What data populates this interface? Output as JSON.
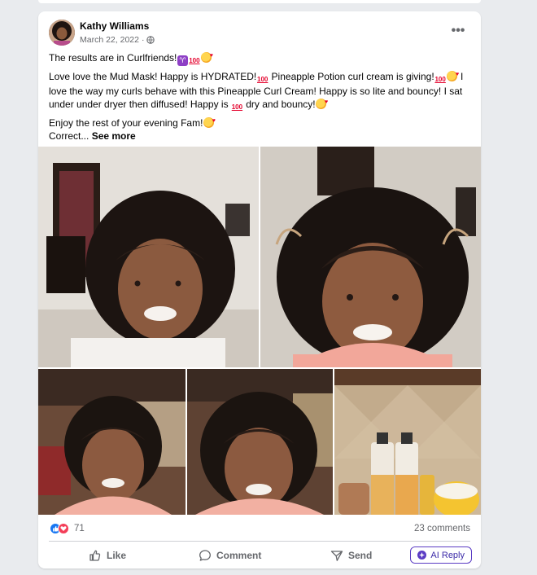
{
  "post": {
    "author": "Kathy Williams",
    "date": "March 22, 2022",
    "separator": "·",
    "privacy_icon": "globe-icon",
    "more_icon": "more-options-icon",
    "more_glyph": "•••",
    "paragraphs": {
      "p1": "The results are in Curlfriends!",
      "p2a": "Love love the Mud Mask! Happy is HYDRATED!",
      "p2b": " Pineapple Potion curl cream is giving!",
      "p2c": " I love the way my curls behave with this Pineapple Curl Cream! Happy is so lite and bouncy! I sat under under dryer then diffused! Happy is ",
      "p2d": " dry and bouncy!",
      "p3": "Enjoy the rest of your evening Fam!",
      "p4": "Correct... "
    },
    "see_more": "See more",
    "emojis": {
      "aries": "♈",
      "hundred": "100",
      "love": "smiling-face-with-hearts"
    }
  },
  "photos": [
    {
      "name": "photo-selfie-1",
      "alt": "selfie in hallway"
    },
    {
      "name": "photo-selfie-2",
      "alt": "selfie with pink top"
    },
    {
      "name": "photo-selfie-3",
      "alt": "selfie in kitchen"
    },
    {
      "name": "photo-selfie-4",
      "alt": "selfie in kitchen close"
    },
    {
      "name": "photo-products",
      "alt": "hair products on counter"
    }
  ],
  "stats": {
    "reaction_count": "71",
    "comments": "23 comments"
  },
  "actions": {
    "like": "Like",
    "comment": "Comment",
    "send": "Send",
    "ai_reply": "AI Reply"
  },
  "colors": {
    "like_blue": "#1877f2",
    "heart_red": "#f33e58",
    "ai_purple": "#5b3cc4",
    "muted_text": "#65676b"
  }
}
